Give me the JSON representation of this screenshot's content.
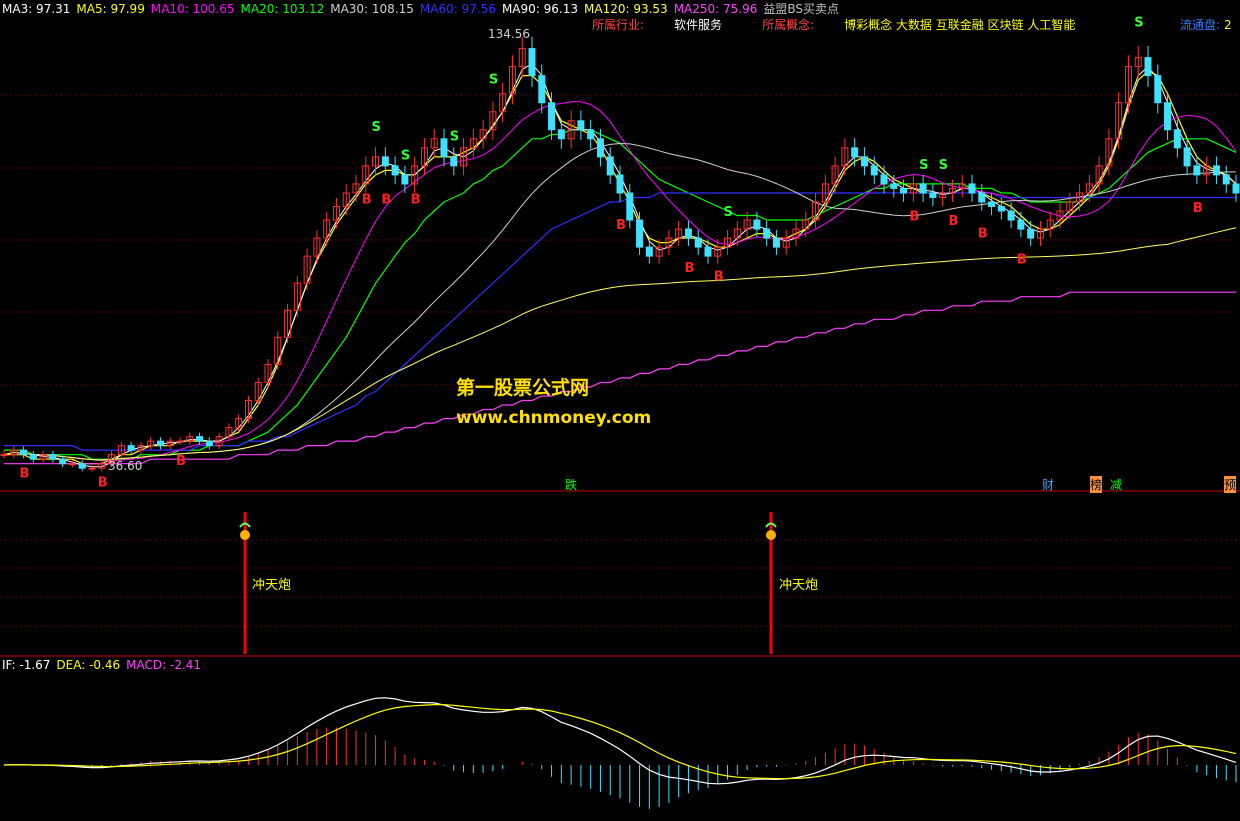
{
  "header": {
    "ma_values": [
      {
        "label": "MA3: 97.31",
        "color": "#ffffff"
      },
      {
        "label": "MA5: 97.99",
        "color": "#ffff00"
      },
      {
        "label": "MA10: 100.65",
        "color": "#ff00ff"
      },
      {
        "label": "MA20: 103.12",
        "color": "#00ff00"
      },
      {
        "label": "MA30: 108.15",
        "color": "#d0d0d0"
      },
      {
        "label": "MA60: 97.56",
        "color": "#3030ff"
      },
      {
        "label": "MA90: 96.13",
        "color": "#ffffff"
      },
      {
        "label": "MA120: 93.53",
        "color": "#ffff40"
      },
      {
        "label": "MA250: 75.96",
        "color": "#ff40ff"
      }
    ],
    "indicator_name": "益盟BS买卖点",
    "industry_label": "所属行业:",
    "industry_value": "软件服务",
    "concept_label": "所属概念:",
    "concept_value": "博彩概念 大数据 互联金融 区块链 人工智能",
    "float_label": "流通盘:",
    "float_value": "2"
  },
  "price_panel": {
    "high_label": "134.56",
    "low_label": "36.60",
    "watermark_cn": "第一股票公式网",
    "watermark_url": "www.chnmoney.com",
    "buy_marker": "B",
    "sell_marker": "S",
    "event_tags": [
      "跌",
      "财",
      "榜",
      "减",
      "预"
    ]
  },
  "signal_panel": {
    "signal_label_1": "冲天炮",
    "signal_label_2": "冲天炮"
  },
  "macd_panel": {
    "dif_label": "IF: -1.67",
    "dea_label": "DEA: -0.46",
    "macd_label": "MACD: -2.41"
  },
  "chart_data": {
    "type": "line",
    "title": "",
    "price_high": 134.56,
    "price_low": 36.6,
    "close_series": [
      40,
      41,
      40,
      39,
      40,
      39,
      38,
      38,
      37,
      37,
      38,
      40,
      42,
      41,
      42,
      43,
      42,
      43,
      43,
      44,
      43,
      42,
      44,
      46,
      48,
      52,
      56,
      60,
      66,
      72,
      78,
      84,
      88,
      92,
      95,
      98,
      100,
      104,
      106,
      104,
      102,
      100,
      104,
      108,
      110,
      106,
      104,
      108,
      110,
      112,
      116,
      120,
      126,
      130,
      124,
      118,
      112,
      110,
      114,
      112,
      110,
      106,
      102,
      98,
      92,
      86,
      84,
      86,
      88,
      90,
      88,
      86,
      84,
      86,
      88,
      90,
      92,
      90,
      88,
      86,
      88,
      90,
      92,
      96,
      100,
      104,
      108,
      106,
      104,
      102,
      100,
      99,
      98,
      100,
      98,
      97,
      98,
      99,
      100,
      98,
      96,
      95,
      94,
      92,
      90,
      88,
      90,
      92,
      94,
      96,
      98,
      100,
      104,
      110,
      118,
      126,
      128,
      124,
      118,
      112,
      108,
      104,
      102,
      104,
      102,
      100,
      98
    ],
    "ma_lines": [
      {
        "name": "MA5",
        "color": "#ffff00",
        "values": [
          40,
          40,
          40,
          39,
          39,
          39,
          39,
          39,
          38,
          38,
          38,
          39,
          40,
          40,
          41,
          42,
          42,
          42,
          43,
          43,
          43,
          43,
          43,
          44,
          45,
          48,
          51,
          55,
          60,
          66,
          72,
          78,
          83,
          87,
          91,
          94,
          97,
          100,
          102,
          103,
          103,
          102,
          102,
          104,
          106,
          106,
          106,
          107,
          108,
          110,
          113,
          116,
          120,
          124,
          124,
          122,
          118,
          114,
          113,
          112,
          111,
          108,
          104,
          100,
          96,
          91,
          88,
          87,
          87,
          88,
          88,
          88,
          87,
          86,
          86,
          87,
          88,
          89,
          89,
          88,
          88,
          89,
          90,
          92,
          95,
          99,
          103,
          105,
          106,
          105,
          103,
          101,
          100,
          99,
          98,
          98,
          98,
          98,
          99,
          99,
          98,
          97,
          96,
          95,
          93,
          91,
          90,
          90,
          91,
          93,
          95,
          97,
          100,
          104,
          110,
          117,
          123,
          125,
          124,
          120,
          115,
          110,
          106,
          104,
          103,
          102,
          100
        ]
      },
      {
        "name": "MA20",
        "color": "#00ff00",
        "values": [
          41,
          41,
          41,
          40,
          40,
          40,
          40,
          40,
          40,
          39,
          39,
          39,
          39,
          39,
          40,
          40,
          40,
          40,
          41,
          41,
          41,
          42,
          42,
          42,
          42,
          43,
          44,
          45,
          47,
          49,
          51,
          54,
          57,
          60,
          63,
          66,
          70,
          74,
          78,
          81,
          84,
          87,
          89,
          92,
          94,
          96,
          97,
          98,
          100,
          101,
          103,
          104,
          106,
          108,
          110,
          110,
          111,
          111,
          112,
          112,
          112,
          111,
          110,
          109,
          107,
          105,
          103,
          101,
          100,
          99,
          98,
          97,
          96,
          95,
          94,
          93,
          93,
          93,
          92,
          92,
          92,
          92,
          92,
          93,
          94,
          95,
          96,
          97,
          98,
          99,
          99,
          100,
          100,
          100,
          100,
          100,
          100,
          100,
          100,
          99,
          99,
          99,
          98,
          98,
          97,
          96,
          96,
          96,
          96,
          96,
          96,
          97,
          98,
          99,
          101,
          103,
          105,
          107,
          108,
          109,
          110,
          110,
          110,
          110,
          109,
          108,
          107
        ]
      },
      {
        "name": "MA60",
        "color": "#3030ff",
        "values": [
          42,
          42,
          42,
          42,
          42,
          42,
          42,
          42,
          41,
          41,
          41,
          41,
          41,
          41,
          41,
          41,
          41,
          41,
          41,
          41,
          42,
          42,
          42,
          42,
          42,
          43,
          43,
          43,
          44,
          44,
          45,
          46,
          47,
          48,
          49,
          50,
          51,
          53,
          54,
          56,
          58,
          60,
          62,
          64,
          66,
          68,
          70,
          72,
          74,
          76,
          78,
          80,
          82,
          84,
          86,
          88,
          90,
          91,
          92,
          93,
          94,
          95,
          96,
          96,
          97,
          97,
          97,
          98,
          98,
          98,
          98,
          98,
          98,
          98,
          98,
          98,
          98,
          98,
          98,
          98,
          98,
          98,
          98,
          98,
          98,
          98,
          98,
          98,
          98,
          98,
          98,
          98,
          98,
          98,
          98,
          98,
          98,
          98,
          98,
          98,
          98,
          98,
          97,
          97,
          97,
          97,
          97,
          97,
          97,
          97,
          97,
          97,
          97,
          97,
          97,
          97,
          97,
          97,
          97,
          97,
          97,
          97,
          97,
          97,
          97,
          97,
          97
        ]
      },
      {
        "name": "MA250",
        "color": "#ff40ff",
        "values": [
          38,
          38,
          38,
          38,
          38,
          38,
          38,
          38,
          38,
          38,
          38,
          38,
          38,
          38,
          38,
          39,
          39,
          39,
          39,
          39,
          39,
          39,
          39,
          39,
          40,
          40,
          40,
          40,
          41,
          41,
          41,
          42,
          42,
          42,
          43,
          43,
          43,
          44,
          44,
          45,
          45,
          46,
          46,
          47,
          47,
          48,
          48,
          49,
          49,
          50,
          50,
          51,
          51,
          52,
          52,
          53,
          53,
          54,
          54,
          55,
          55,
          56,
          56,
          57,
          57,
          58,
          58,
          59,
          59,
          60,
          60,
          61,
          61,
          62,
          62,
          63,
          63,
          64,
          64,
          65,
          65,
          66,
          66,
          67,
          67,
          68,
          68,
          69,
          69,
          70,
          70,
          70,
          71,
          71,
          72,
          72,
          72,
          73,
          73,
          73,
          74,
          74,
          74,
          74,
          75,
          75,
          75,
          75,
          75,
          76,
          76,
          76,
          76,
          76,
          76,
          76,
          76,
          76,
          76,
          76,
          76,
          76,
          76,
          76,
          76,
          76,
          76
        ]
      }
    ]
  }
}
